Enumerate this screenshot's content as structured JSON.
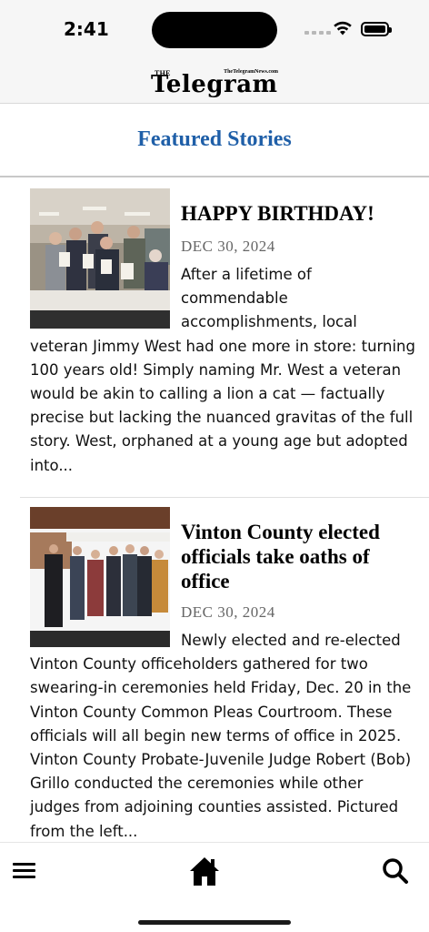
{
  "status_bar": {
    "time": "2:41"
  },
  "masthead": {
    "small_text": "THE",
    "name": "Telegram",
    "site": "TheTelegramNews.com"
  },
  "section": {
    "title": "Featured Stories"
  },
  "articles": [
    {
      "headline": "HAPPY BIRTHDAY!",
      "date": "DEC 30, 2024",
      "excerpt": "After a lifetime of commendable accomplishments, local veteran Jimmy West had one more in store: turning 100 years old! Simply naming Mr. West a veteran would be akin to calling a lion a cat — factually precise but lacking the nuanced gravitas of the full story. West, orphaned at a young age but adopted into..."
    },
    {
      "headline": "Vinton County elected officials take oaths of office",
      "date": "DEC 30, 2024",
      "excerpt": "Newly elected and re-elected Vinton County officeholders gathered for two swearing-in ceremonies held Friday, Dec. 20 in the Vinton County Common Pleas Courtroom. These officials will all begin new terms of office in 2025. Vinton County Probate-Juvenile Judge Robert (Bob) Grillo conducted the ceremonies while other judges from adjoining counties assisted.  Pictured from the left..."
    }
  ],
  "toolbar": {
    "menu_icon": "menu-icon",
    "home_icon": "home-icon",
    "search_icon": "search-icon"
  },
  "colors": {
    "section_title": "#1f5fa8",
    "date_text": "#666666"
  }
}
